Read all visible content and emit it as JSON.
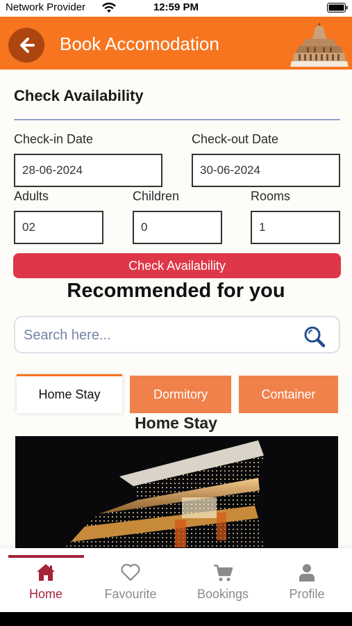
{
  "status_bar": {
    "carrier": "Network Provider",
    "time": "12:59 PM"
  },
  "header": {
    "title": "Book Accomodation"
  },
  "availability": {
    "section_title": "Check Availability",
    "check_in_label": "Check-in Date",
    "check_in_value": "28-06-2024",
    "check_out_label": "Check-out Date",
    "check_out_value": "30-06-2024",
    "adults_label": "Adults",
    "adults_value": "02",
    "children_label": "Children",
    "children_value": "0",
    "rooms_label": "Rooms",
    "rooms_value": "1",
    "button_label": "Check Availability"
  },
  "recommended": {
    "heading": "Recommended for you",
    "search_placeholder": "Search here...",
    "tabs": [
      {
        "label": "Home Stay",
        "active": true
      },
      {
        "label": "Dormitory",
        "active": false
      },
      {
        "label": "Container",
        "active": false
      }
    ],
    "current_category_title": "Home Stay"
  },
  "bottom_nav": {
    "items": [
      {
        "label": "Home",
        "icon": "home-icon",
        "active": true
      },
      {
        "label": "Favourite",
        "icon": "heart-icon",
        "active": false
      },
      {
        "label": "Bookings",
        "icon": "cart-icon",
        "active": false
      },
      {
        "label": "Profile",
        "icon": "user-icon",
        "active": false
      }
    ]
  },
  "colors": {
    "brand_orange": "#f7751f",
    "primary_red": "#de3748",
    "nav_active": "#a5243a",
    "tab_inactive": "#f0814b"
  }
}
